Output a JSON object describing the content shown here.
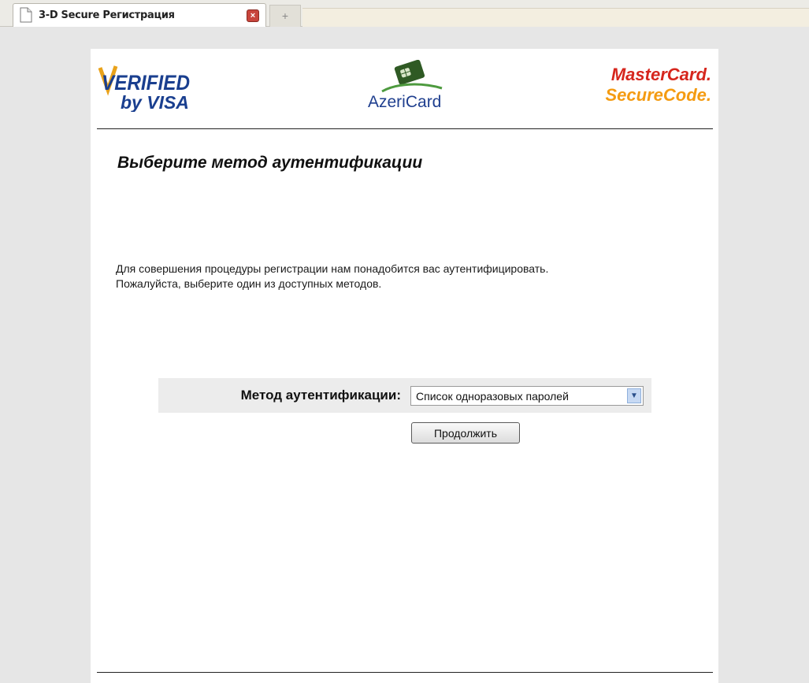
{
  "browser": {
    "tab_title": "3-D Secure Регистрация",
    "tab_close_glyph": "×",
    "new_tab_glyph": "+"
  },
  "logos": {
    "visa_line1": "VERIFIED",
    "visa_line2": "by VISA",
    "azericard": "AzeriCard",
    "mastercard_line1": "MasterCard.",
    "mastercard_line2": "SecureCode."
  },
  "page": {
    "title": "Выберите метод аутентификации",
    "intro_line1": "Для совершения процедуры регистрации нам понадобится вас аутентифицировать.",
    "intro_line2": "Пожалуйста, выберите один из доступных методов."
  },
  "form": {
    "method_label": "Метод аутентификации:",
    "method_selected": "Список одноразовых паролей",
    "continue_label": "Продолжить"
  },
  "colors": {
    "visa_blue": "#1a3f8f",
    "visa_gold": "#e9a21a",
    "azeri_green": "#4d9a3e",
    "mastercard_red": "#d6261d",
    "mastercard_orange": "#f49b12"
  }
}
